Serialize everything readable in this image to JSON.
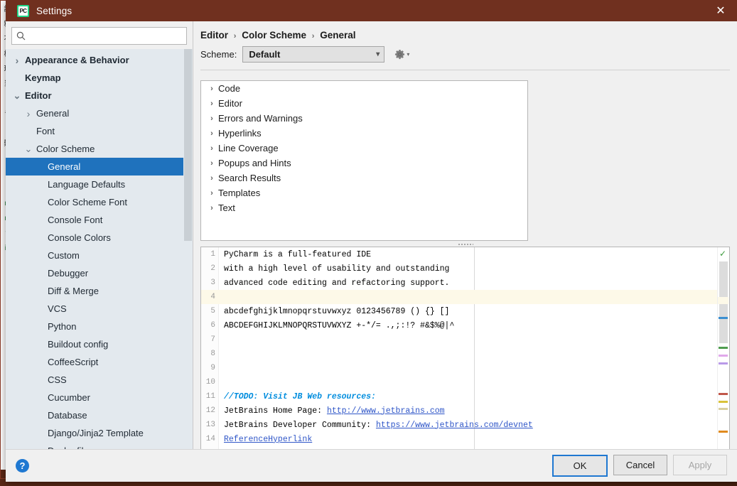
{
  "window": {
    "title": "Settings",
    "app_icon": "pycharm-icon",
    "close_icon": "close-icon"
  },
  "search": {
    "placeholder": "",
    "value": "",
    "icon": "search-icon"
  },
  "sidebar": {
    "items": [
      {
        "label": "Appearance & Behavior",
        "level": 0,
        "arrow": "collapsed",
        "bold": true,
        "selected": false
      },
      {
        "label": "Keymap",
        "level": 0,
        "arrow": "none",
        "bold": true,
        "selected": false
      },
      {
        "label": "Editor",
        "level": 0,
        "arrow": "expanded",
        "bold": true,
        "selected": false
      },
      {
        "label": "General",
        "level": 1,
        "arrow": "collapsed",
        "bold": false,
        "selected": false
      },
      {
        "label": "Font",
        "level": 1,
        "arrow": "none",
        "bold": false,
        "selected": false
      },
      {
        "label": "Color Scheme",
        "level": 1,
        "arrow": "expanded",
        "bold": false,
        "selected": false
      },
      {
        "label": "General",
        "level": 2,
        "arrow": "none",
        "bold": false,
        "selected": true
      },
      {
        "label": "Language Defaults",
        "level": 2,
        "arrow": "none",
        "bold": false,
        "selected": false
      },
      {
        "label": "Color Scheme Font",
        "level": 2,
        "arrow": "none",
        "bold": false,
        "selected": false
      },
      {
        "label": "Console Font",
        "level": 2,
        "arrow": "none",
        "bold": false,
        "selected": false
      },
      {
        "label": "Console Colors",
        "level": 2,
        "arrow": "none",
        "bold": false,
        "selected": false
      },
      {
        "label": "Custom",
        "level": 2,
        "arrow": "none",
        "bold": false,
        "selected": false
      },
      {
        "label": "Debugger",
        "level": 2,
        "arrow": "none",
        "bold": false,
        "selected": false
      },
      {
        "label": "Diff & Merge",
        "level": 2,
        "arrow": "none",
        "bold": false,
        "selected": false
      },
      {
        "label": "VCS",
        "level": 2,
        "arrow": "none",
        "bold": false,
        "selected": false
      },
      {
        "label": "Python",
        "level": 2,
        "arrow": "none",
        "bold": false,
        "selected": false
      },
      {
        "label": "Buildout config",
        "level": 2,
        "arrow": "none",
        "bold": false,
        "selected": false
      },
      {
        "label": "CoffeeScript",
        "level": 2,
        "arrow": "none",
        "bold": false,
        "selected": false
      },
      {
        "label": "CSS",
        "level": 2,
        "arrow": "none",
        "bold": false,
        "selected": false
      },
      {
        "label": "Cucumber",
        "level": 2,
        "arrow": "none",
        "bold": false,
        "selected": false
      },
      {
        "label": "Database",
        "level": 2,
        "arrow": "none",
        "bold": false,
        "selected": false
      },
      {
        "label": "Django/Jinja2 Template",
        "level": 2,
        "arrow": "none",
        "bold": false,
        "selected": false
      },
      {
        "label": "Dockerfile",
        "level": 2,
        "arrow": "none",
        "bold": false,
        "selected": false
      }
    ]
  },
  "content": {
    "breadcrumb": [
      "Editor",
      "Color Scheme",
      "General"
    ],
    "breadcrumb_separator": "›",
    "scheme_label": "Scheme:",
    "scheme_value": "Default",
    "gear_icon": "gear-icon",
    "categories": [
      "Code",
      "Editor",
      "Errors and Warnings",
      "Hyperlinks",
      "Line Coverage",
      "Popups and Hints",
      "Search Results",
      "Templates",
      "Text"
    ]
  },
  "preview": {
    "lines": [
      {
        "num": "1",
        "text": "PyCharm is a full-featured IDE",
        "caret": false
      },
      {
        "num": "2",
        "text": "with a high level of usability and outstanding",
        "caret": false
      },
      {
        "num": "3",
        "text": "advanced code editing and refactoring support.",
        "caret": false
      },
      {
        "num": "4",
        "text": "",
        "caret": true
      },
      {
        "num": "5",
        "text": "abcdefghijklmnopqrstuvwxyz 0123456789 () {} []",
        "caret": false
      },
      {
        "num": "6",
        "text": "ABCDEFGHIJKLMNOPQRSTUVWXYZ +-*/= .,;:!? #&$%@|^",
        "caret": false
      },
      {
        "num": "7",
        "text": "",
        "caret": false
      },
      {
        "num": "8",
        "text": "",
        "caret": false
      },
      {
        "num": "9",
        "text": "",
        "caret": false
      },
      {
        "num": "10",
        "text": "",
        "caret": false
      },
      {
        "num": "11",
        "text": "//TODO: Visit JB Web resources:",
        "caret": false,
        "style": "todo"
      },
      {
        "num": "12",
        "text": "JetBrains Home Page: ",
        "caret": false,
        "link": "http://www.jetbrains.com"
      },
      {
        "num": "13",
        "text": "JetBrains Developer Community: ",
        "caret": false,
        "link": "https://www.jetbrains.com/devnet"
      },
      {
        "num": "14",
        "text": "",
        "caret": false,
        "reflink": "ReferenceHyperlink"
      }
    ],
    "status_icon": "checkmark-ok-icon"
  },
  "footer": {
    "help_icon": "?",
    "ok_label": "OK",
    "cancel_label": "Cancel",
    "apply_label": "Apply",
    "apply_enabled": false
  },
  "colors": {
    "titlebar": "#70301f",
    "selection": "#1f72bd",
    "accent_button_border": "#1f78d1",
    "link": "#2f56c8",
    "todo": "#008dde",
    "caret_row": "#fdf9e8"
  }
}
